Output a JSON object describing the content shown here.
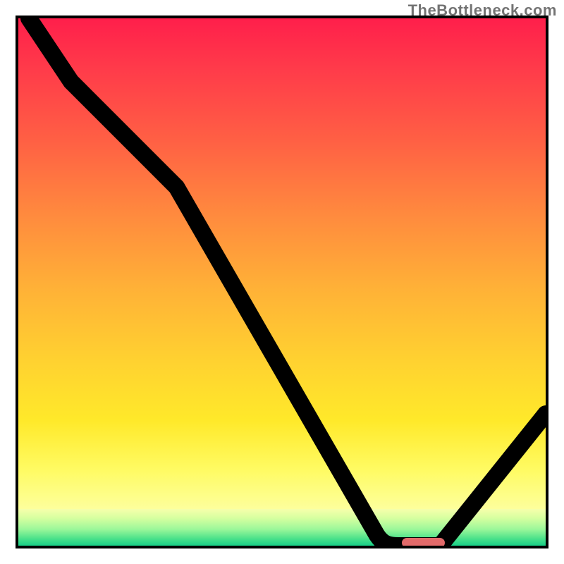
{
  "watermark": "TheBottleneck.com",
  "chart_data": {
    "type": "line",
    "title": "",
    "xlabel": "",
    "ylabel": "",
    "xlim": [
      0,
      100
    ],
    "ylim": [
      0,
      100
    ],
    "grid": false,
    "series": [
      {
        "name": "bottleneck-curve",
        "x": [
          2,
          10,
          26,
          30,
          68,
          75,
          80,
          100
        ],
        "y": [
          100,
          88,
          72,
          68,
          2,
          0,
          0,
          25
        ]
      }
    ],
    "marker": {
      "x_start": 72,
      "x_end": 80,
      "y": 0
    },
    "gradient_stops_pct": [
      0,
      93,
      100
    ],
    "background": "bottleneck-gradient"
  }
}
